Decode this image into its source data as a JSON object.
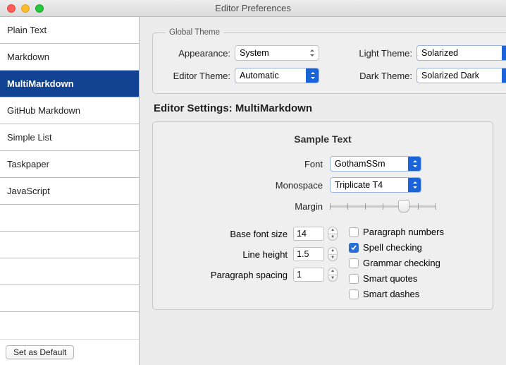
{
  "window": {
    "title": "Editor Preferences"
  },
  "sidebar": {
    "items": [
      {
        "label": "Plain Text"
      },
      {
        "label": "Markdown"
      },
      {
        "label": "MultiMarkdown"
      },
      {
        "label": "GitHub Markdown"
      },
      {
        "label": "Simple List"
      },
      {
        "label": "Taskpaper"
      },
      {
        "label": "JavaScript"
      }
    ],
    "selected_index": 2,
    "footer_button": "Set as Default"
  },
  "global_theme": {
    "legend": "Global Theme",
    "appearance": {
      "label": "Appearance:",
      "value": "System"
    },
    "editor_theme": {
      "label": "Editor Theme:",
      "value": "Automatic"
    },
    "light_theme": {
      "label": "Light Theme:",
      "value": "Solarized"
    },
    "dark_theme": {
      "label": "Dark Theme:",
      "value": "Solarized Dark"
    }
  },
  "editor_settings": {
    "heading": "Editor Settings: MultiMarkdown",
    "sample_title": "Sample Text",
    "font": {
      "label": "Font",
      "value": "GothamSSm"
    },
    "monospace": {
      "label": "Monospace",
      "value": "Triplicate T4"
    },
    "margin": {
      "label": "Margin"
    },
    "base_font_size": {
      "label": "Base font size",
      "value": "14"
    },
    "line_height": {
      "label": "Line height",
      "value": "1.5"
    },
    "paragraph_spacing": {
      "label": "Paragraph spacing",
      "value": "1"
    },
    "checkboxes": {
      "paragraph_numbers": {
        "label": "Paragraph numbers",
        "checked": false
      },
      "spell_checking": {
        "label": "Spell checking",
        "checked": true
      },
      "grammar_checking": {
        "label": "Grammar checking",
        "checked": false
      },
      "smart_quotes": {
        "label": "Smart quotes",
        "checked": false
      },
      "smart_dashes": {
        "label": "Smart dashes",
        "checked": false
      }
    }
  }
}
